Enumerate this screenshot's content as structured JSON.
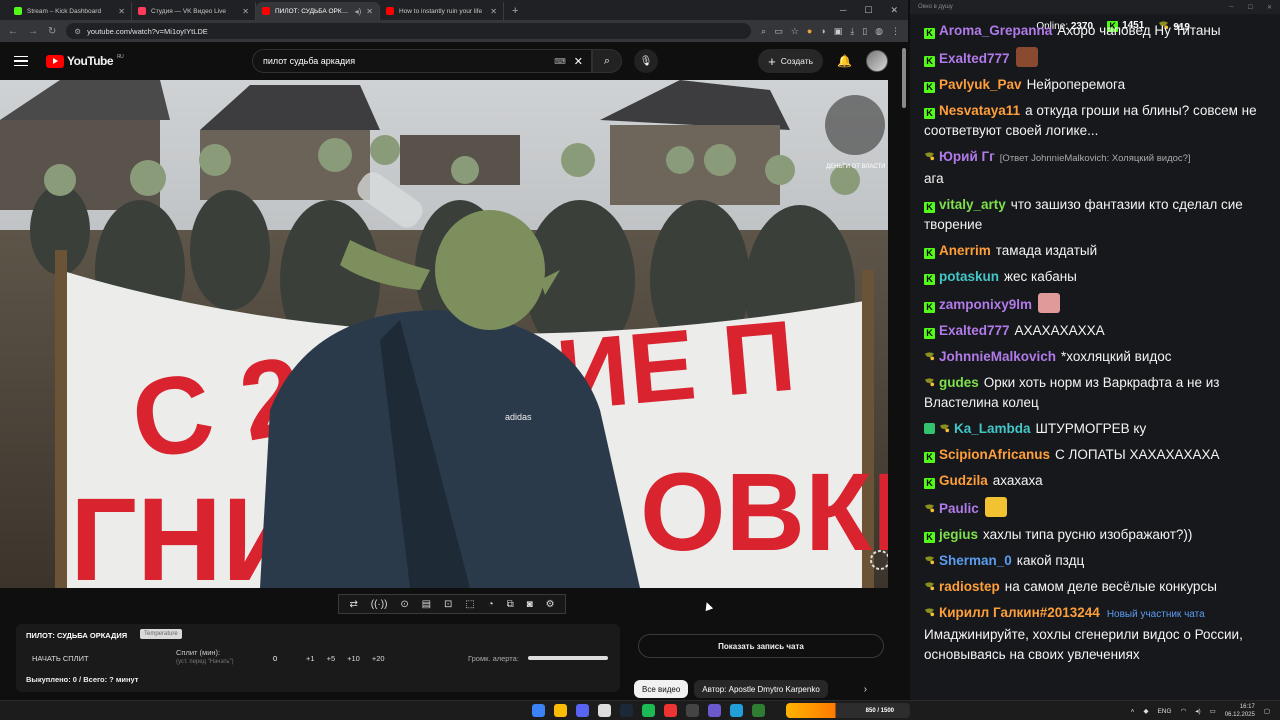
{
  "browser": {
    "tabs": [
      {
        "label": "Stream – Kick Dashboard",
        "color": "#53fc18",
        "active": false
      },
      {
        "label": "Студия — VK Видео Live",
        "color": "#ff3b5c",
        "active": false
      },
      {
        "label": "ПИЛОТ: СУДЬБА ОРКАДИ",
        "color": "#ff0000",
        "active": true
      },
      {
        "label": "How to instantly ruin your life",
        "color": "#ff0000",
        "active": false
      }
    ],
    "url": "youtube.com/watch?v=Mi1oyIYtLDE"
  },
  "youtube": {
    "logo_text": "YouTube",
    "region": "RU",
    "search_query": "пилот судьба аркадия",
    "create_label": "Создать"
  },
  "stream_panel": {
    "title": "ПИЛОТ: СУДЬБА ОРКАДИЯ",
    "badge": "Temperature",
    "start_label": "НАЧАТЬ СПЛИТ",
    "split_label": "Сплит (мин):",
    "split_sub": "(уст. перед \"Начать\")",
    "split_value": "0",
    "increments": [
      "+1",
      "+5",
      "+10",
      "+20"
    ],
    "volume_label": "Громк. алерта:",
    "volume_level": 1.0,
    "stats": "Выкуплено: 0 / Всего: ? минут"
  },
  "chat_replay_label": "Показать запись чата",
  "chips": {
    "all": "Все видео",
    "author": "Автор: Apostle Dmytro Karpenko"
  },
  "chat": {
    "window_title": "Окно в душу",
    "online_label": "Online:",
    "online_count": "2370",
    "kick_count": "1451",
    "vk_count": "919",
    "messages": [
      {
        "platform": "kick",
        "user": "Aroma_Grepanna",
        "color": "#b07ae8",
        "text": "Ахоро чаповед Ну Титаны"
      },
      {
        "platform": "kick",
        "user": "Exalted777",
        "color": "#b07ae8",
        "text": "",
        "emote": "#8a4a2f"
      },
      {
        "platform": "kick",
        "user": "Pavlyuk_Pav",
        "color": "#ff9f3a",
        "text": "Нейроперемога"
      },
      {
        "platform": "kick",
        "user": "Nesvataya11",
        "color": "#ff9f3a",
        "text": "а откуда гроши на блины? совсем не соответвуют своей логике..."
      },
      {
        "platform": "vk",
        "user": "Юрий Гг",
        "color": "#b07ae8",
        "reply": "[Ответ JohnnieMalkovich: Холяцкий видос?]",
        "text": "ага"
      },
      {
        "platform": "kick",
        "user": "vitaly_arty",
        "color": "#7ee04a",
        "text": "что зашизо фантазии кто сделал сие творение"
      },
      {
        "platform": "kick",
        "user": "Anerrim",
        "color": "#ff9f3a",
        "text": "тамада издатый"
      },
      {
        "platform": "kick",
        "user": "potaskun",
        "color": "#43c6c6",
        "text": "жес кабаны"
      },
      {
        "platform": "kick",
        "user": "zamponixy9lm",
        "color": "#b07ae8",
        "text": "",
        "emote": "#e09a9a"
      },
      {
        "platform": "kick",
        "user": "Exalted777",
        "color": "#b07ae8",
        "text": "АХАХАХАХХА"
      },
      {
        "platform": "vk",
        "user": "JohnnieMalkovich",
        "color": "#b07ae8",
        "text": "*хохляцкий видос"
      },
      {
        "platform": "vk",
        "user": "gudes",
        "color": "#7ee04a",
        "text": "Орки хоть норм из Варкрафта а не из Властелина колец"
      },
      {
        "platform": "vk",
        "user": "Ka_Lambda",
        "color": "#43c6c6",
        "text": "ШТУРМОГРЕВ ку",
        "badge": true
      },
      {
        "platform": "kick",
        "user": "ScipionAfricanus",
        "color": "#ff9f3a",
        "text": "С ЛОПАТЫ ХАХАХАХАХА"
      },
      {
        "platform": "kick",
        "user": "Gudzila",
        "color": "#ff9f3a",
        "text": "ахахаха"
      },
      {
        "platform": "vk",
        "user": "Paulic",
        "color": "#b07ae8",
        "text": "",
        "emote": "#f1c232"
      },
      {
        "platform": "kick",
        "user": "jegius",
        "color": "#7ee04a",
        "text": "хахлы типа русню изображают?))"
      },
      {
        "platform": "vk",
        "user": "Sherman_0",
        "color": "#5b9cf0",
        "text": "какой пздц"
      },
      {
        "platform": "vk",
        "user": "radiostep",
        "color": "#ff9f3a",
        "text": "на самом деле весёлые конкурсы"
      },
      {
        "platform": "vk",
        "user": "Кирилл Галкин#2013244",
        "color": "#ff9f3a",
        "newbie": "Новый участник чата",
        "text": "Имаджинируйте, хохлы сгенерили видос о России, основываясь на своих увлечениях"
      }
    ]
  },
  "taskbar": {
    "lang": "ENG",
    "time": "16:17",
    "date": "06.12.2025",
    "promo": "850 / 1500"
  },
  "video": {
    "banner_line1": "С 200",
    "banner_line1b": "ИЕ П",
    "banner_line2": "ГНИЛО",
    "banner_line2b": "ОВКИ",
    "watermark": "ДЕНЬГИ ОТ ВЛАСТИ"
  }
}
